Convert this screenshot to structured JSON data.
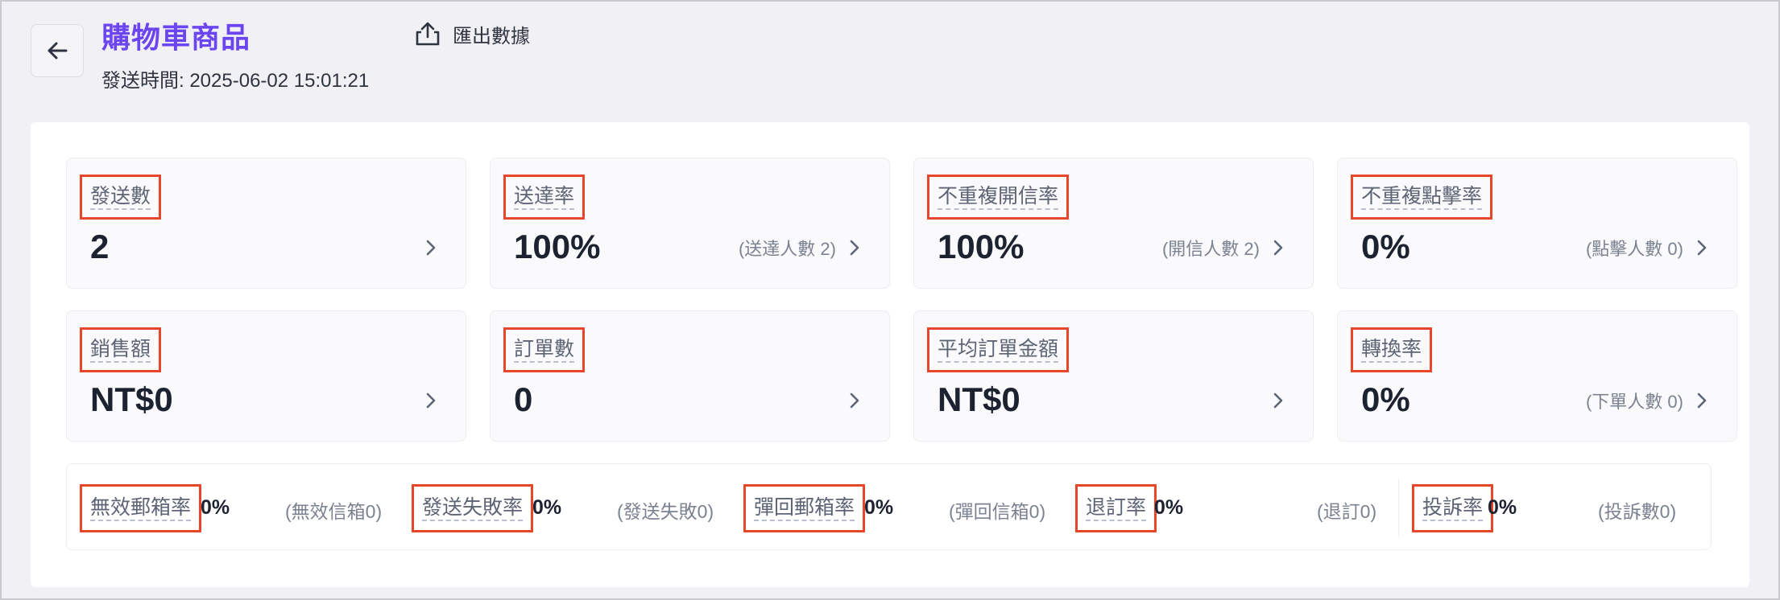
{
  "header": {
    "title": "購物車商品",
    "send_time": "發送時間: 2025-06-02 15:01:21",
    "export_label": "匯出數據"
  },
  "metrics": [
    {
      "label": "發送數",
      "value": "2",
      "sub": ""
    },
    {
      "label": "送達率",
      "value": "100%",
      "sub": "(送達人數 2)"
    },
    {
      "label": "不重複開信率",
      "value": "100%",
      "sub": "(開信人數 2)"
    },
    {
      "label": "不重複點擊率",
      "value": "0%",
      "sub": "(點擊人數 0)"
    },
    {
      "label": "銷售額",
      "value": "NT$0",
      "sub": ""
    },
    {
      "label": "訂單數",
      "value": "0",
      "sub": ""
    },
    {
      "label": "平均訂單金額",
      "value": "NT$0",
      "sub": ""
    },
    {
      "label": "轉換率",
      "value": "0%",
      "sub": "(下單人數 0)"
    }
  ],
  "rates": [
    {
      "label": "無效郵箱率",
      "value": "0%",
      "sub": "(無效信箱0)"
    },
    {
      "label": "發送失敗率",
      "value": "0%",
      "sub": "(發送失敗0)"
    },
    {
      "label": "彈回郵箱率",
      "value": "0%",
      "sub": "(彈回信箱0)"
    },
    {
      "label": "退訂率",
      "value": "0%",
      "sub": "(退訂0)"
    },
    {
      "label": "投訴率",
      "value": "0%",
      "sub": "(投訴數0)"
    }
  ],
  "colors": {
    "accent": "#6b45f0",
    "highlight_box": "#e8462a"
  }
}
